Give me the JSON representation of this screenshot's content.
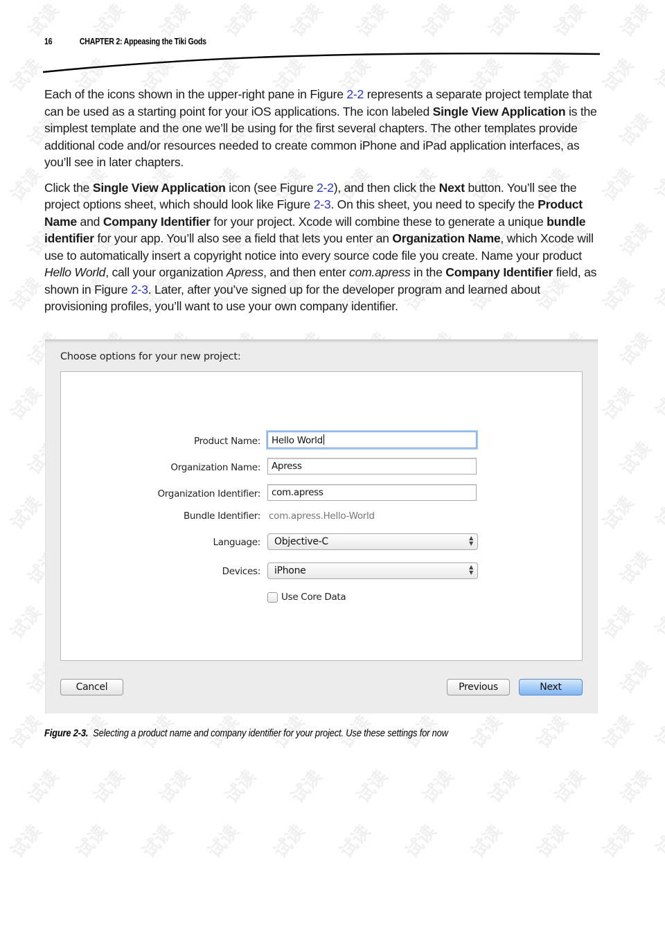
{
  "running_head": {
    "page_number": "16",
    "chapter_title": "CHAPTER 2: Appeasing the Tiki Gods"
  },
  "paragraphs": [
    [
      {
        "t": "Each of the icons shown in the upper-right pane in Figure "
      },
      {
        "t": "2-2",
        "link": true
      },
      {
        "t": " represents a separate project template that can be used as a starting point for your iOS applications. The icon labeled "
      },
      {
        "t": "Single View Application",
        "bold": true
      },
      {
        "t": " is the simplest template and the one we’ll be using for the first several chapters. The other templates provide additional code and/or resources needed to create common iPhone and iPad application interfaces, as you’ll see in later chapters."
      }
    ],
    [
      {
        "t": "Click the "
      },
      {
        "t": "Single View Application",
        "bold": true
      },
      {
        "t": " icon (see Figure "
      },
      {
        "t": "2-2",
        "link": true
      },
      {
        "t": "), and then click the "
      },
      {
        "t": "Next",
        "bold": true
      },
      {
        "t": " button. You’ll see the project options sheet, which should look like Figure "
      },
      {
        "t": "2-3",
        "link": true
      },
      {
        "t": ". On this sheet, you need to specify the "
      },
      {
        "t": "Product Name",
        "bold": true
      },
      {
        "t": " and "
      },
      {
        "t": "Company Identifier",
        "bold": true
      },
      {
        "t": " for your project. Xcode will combine these to generate a unique "
      },
      {
        "t": "bundle identifier",
        "bold": true
      },
      {
        "t": " for your app. You’ll also see a field that lets you enter an "
      },
      {
        "t": "Organization Name",
        "bold": true
      },
      {
        "t": ", which Xcode will use to automatically insert a copyright notice into every source code file you create. Name your product "
      },
      {
        "t": "Hello World",
        "italic": true
      },
      {
        "t": ", call your organization "
      },
      {
        "t": "Apress",
        "italic": true
      },
      {
        "t": ", and then enter "
      },
      {
        "t": "com.apress",
        "italic": true
      },
      {
        "t": " in the "
      },
      {
        "t": "Company Identifier",
        "bold": true
      },
      {
        "t": " field, as shown in Figure "
      },
      {
        "t": "2-3",
        "link": true
      },
      {
        "t": ". Later, after you’ve signed up for the developer program and learned about provisioning profiles, you’ll want to use your own company identifier."
      }
    ]
  ],
  "figure": {
    "sheet_title": "Choose options for your new project:",
    "form": {
      "product_name": {
        "label": "Product Name:",
        "value": "Hello World"
      },
      "organization_name": {
        "label": "Organization Name:",
        "value": "Apress"
      },
      "organization_identifier": {
        "label": "Organization Identifier:",
        "value": "com.apress"
      },
      "bundle_identifier": {
        "label": "Bundle Identifier:",
        "value": "com.apress.Hello-World"
      },
      "language": {
        "label": "Language:",
        "value": "Objective-C"
      },
      "devices": {
        "label": "Devices:",
        "value": "iPhone"
      },
      "use_core_data": {
        "label": "Use Core Data",
        "checked": false
      }
    },
    "buttons": {
      "cancel": "Cancel",
      "previous": "Previous",
      "next": "Next"
    },
    "caption_label": "Figure 2-3.",
    "caption_text": "Selecting a product name and company identifier for your project. Use these settings for now"
  },
  "watermark": "试读",
  "colors": {
    "link": "#2a36c9",
    "default_button": "#7fb5f2",
    "focus_ring": "#a9c8f0"
  }
}
